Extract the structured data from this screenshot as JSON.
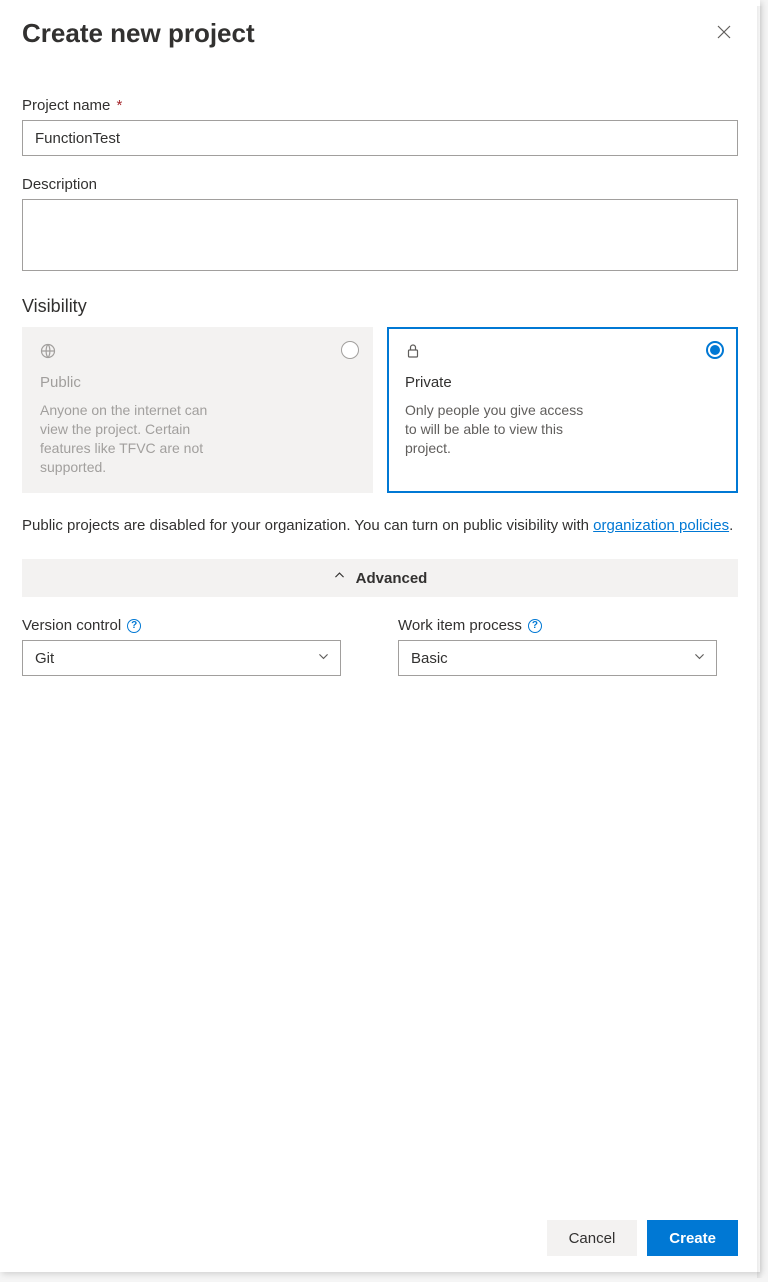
{
  "header": {
    "title": "Create new project"
  },
  "projectName": {
    "label": "Project name",
    "value": "FunctionTest"
  },
  "description": {
    "label": "Description",
    "value": ""
  },
  "visibility": {
    "label": "Visibility",
    "public": {
      "title": "Public",
      "desc": "Anyone on the internet can view the project. Certain features like TFVC are not supported."
    },
    "private": {
      "title": "Private",
      "desc": "Only people you give access to will be able to view this project."
    },
    "info_prefix": "Public projects are disabled for your organization. You can turn on public visibility with ",
    "info_link": "organization policies",
    "info_suffix": "."
  },
  "advanced": {
    "label": "Advanced",
    "versionControl": {
      "label": "Version control",
      "selected": "Git"
    },
    "workItemProcess": {
      "label": "Work item process",
      "selected": "Basic"
    }
  },
  "footer": {
    "cancel": "Cancel",
    "create": "Create"
  }
}
